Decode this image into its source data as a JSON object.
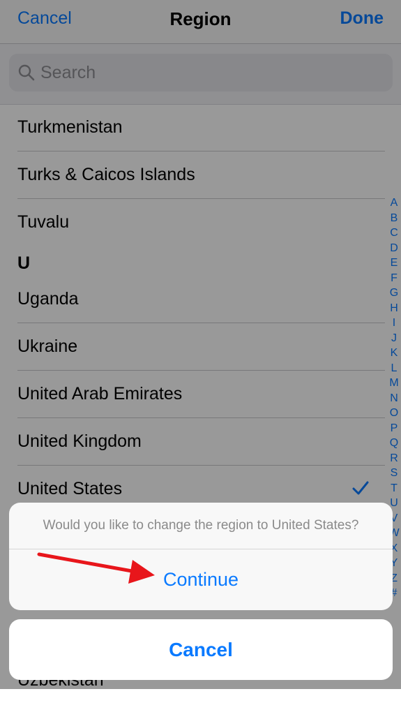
{
  "nav": {
    "cancel": "Cancel",
    "title": "Region",
    "done": "Done"
  },
  "search": {
    "placeholder": "Search"
  },
  "list": {
    "rows_top": [
      {
        "label": "Turkmenistan"
      },
      {
        "label": "Turks & Caicos Islands"
      },
      {
        "label": "Tuvalu"
      }
    ],
    "section_u": "U",
    "rows_u": [
      {
        "label": "Uganda"
      },
      {
        "label": "Ukraine"
      },
      {
        "label": "United Arab Emirates"
      },
      {
        "label": "United Kingdom"
      },
      {
        "label": "United States",
        "selected": true
      }
    ],
    "partial_bottom": "Uzbekistan"
  },
  "index_letters": [
    "A",
    "B",
    "C",
    "D",
    "E",
    "F",
    "G",
    "H",
    "I",
    "J",
    "K",
    "L",
    "M",
    "N",
    "O",
    "P",
    "Q",
    "R",
    "S",
    "T",
    "U",
    "V",
    "W",
    "X",
    "Y",
    "Z",
    "#"
  ],
  "alert": {
    "message": "Would you like to change the region to United States?",
    "continue": "Continue",
    "cancel": "Cancel"
  },
  "colors": {
    "accent": "#0a7aff",
    "annotation": "#e8161b"
  },
  "icons": {
    "search": "search-icon",
    "check": "checkmark-icon"
  }
}
